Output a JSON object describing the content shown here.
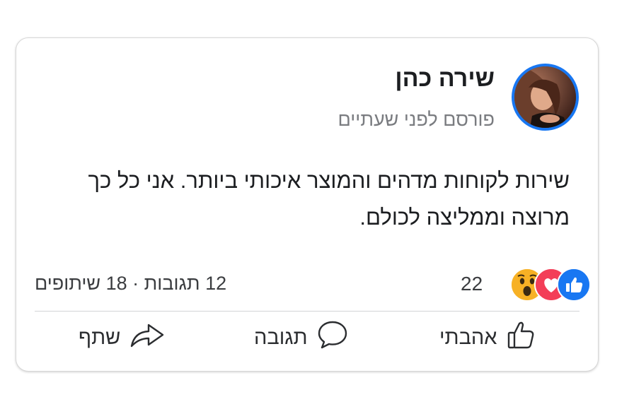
{
  "post": {
    "author": "שירה כהן",
    "timestamp": "פורסם לפני שעתיים",
    "text": "שירות לקוחות מדהים והמוצר איכותי ביותר. אני כל כך מרוצה וממליצה לכולם."
  },
  "reactions": {
    "count": "22",
    "icons": [
      "like-icon",
      "love-icon",
      "wow-icon"
    ],
    "colors": {
      "like": "#1877f2",
      "love": "#f33e58",
      "wow": "#f7b125"
    }
  },
  "stats": {
    "text": "12 תגובות · 18 שיתופים"
  },
  "actions": {
    "like_label": "אהבתי",
    "comment_label": "תגובה",
    "share_label": "שתף"
  },
  "colors": {
    "avatar_ring": "#1877f2",
    "text": "#1c1e21",
    "muted": "#7a7c80"
  }
}
